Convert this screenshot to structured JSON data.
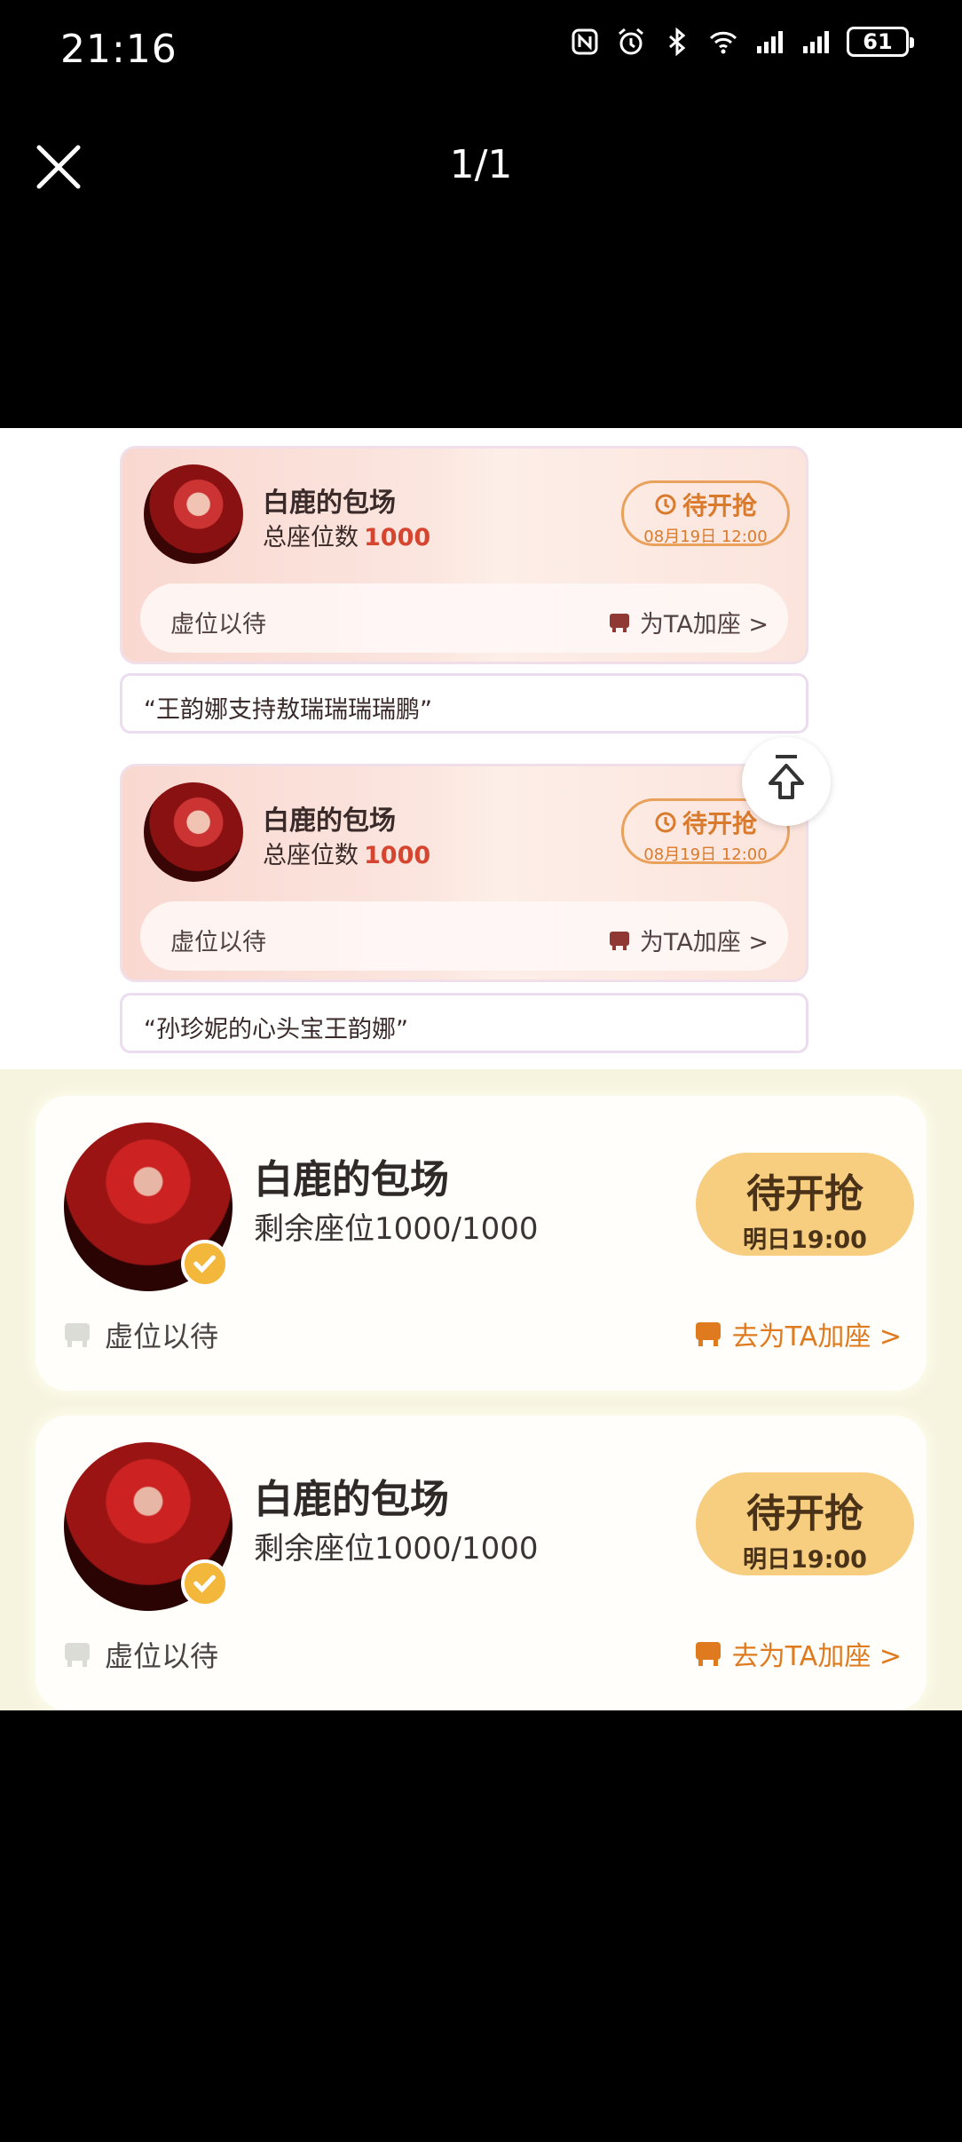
{
  "status_bar": {
    "time": "21:16",
    "battery": "61",
    "icons": [
      "nfc-icon",
      "alarm-icon",
      "bluetooth-icon",
      "wifi-icon",
      "signal-icon",
      "signal-icon"
    ]
  },
  "viewer": {
    "counter": "1/1"
  },
  "old_cards": [
    {
      "title": "白鹿的包场",
      "seats_label": "总座位数",
      "seats_value": "1000",
      "badge_status": "待开抢",
      "badge_time": "08月19日 12:00",
      "wait_label": "虚位以待",
      "add_label": "为TA加座 >",
      "comment": "“王韵娜支持敖瑞瑞瑞瑞鹏”"
    },
    {
      "title": "白鹿的包场",
      "seats_label": "总座位数",
      "seats_value": "1000",
      "badge_status": "待开抢",
      "badge_time": "08月19日 12:00",
      "wait_label": "虚位以待",
      "add_label": "为TA加座 >",
      "comment": "“孙珍妮的心头宝王韵娜”"
    }
  ],
  "new_cards": [
    {
      "title": "白鹿的包场",
      "seats": "剩余座位1000/1000",
      "badge_status": "待开抢",
      "badge_time": "明日19:00",
      "wait_label": "虚位以待",
      "add_label": "去为TA加座 >"
    },
    {
      "title": "白鹿的包场",
      "seats": "剩余座位1000/1000",
      "badge_status": "待开抢",
      "badge_time": "明日19:00",
      "wait_label": "虚位以待",
      "add_label": "去为TA加座 >"
    }
  ],
  "colors": {
    "accent_red": "#d6452f",
    "accent_orange": "#e07a1e",
    "badge_yellow": "#f7ce80"
  }
}
